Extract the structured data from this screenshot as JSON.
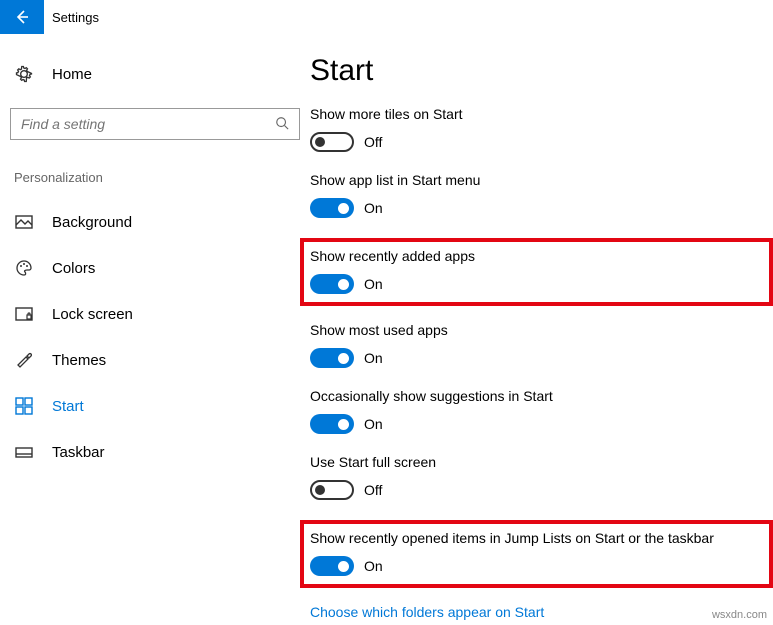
{
  "titlebar": {
    "title": "Settings"
  },
  "sidebar": {
    "home": "Home",
    "search_placeholder": "Find a setting",
    "section": "Personalization",
    "items": [
      {
        "label": "Background"
      },
      {
        "label": "Colors"
      },
      {
        "label": "Lock screen"
      },
      {
        "label": "Themes"
      },
      {
        "label": "Start"
      },
      {
        "label": "Taskbar"
      }
    ]
  },
  "main": {
    "title": "Start",
    "settings": [
      {
        "label": "Show more tiles on Start",
        "state": "Off",
        "on": false,
        "highlight": false
      },
      {
        "label": "Show app list in Start menu",
        "state": "On",
        "on": true,
        "highlight": false
      },
      {
        "label": "Show recently added apps",
        "state": "On",
        "on": true,
        "highlight": true
      },
      {
        "label": "Show most used apps",
        "state": "On",
        "on": true,
        "highlight": false
      },
      {
        "label": "Occasionally show suggestions in Start",
        "state": "On",
        "on": true,
        "highlight": false
      },
      {
        "label": "Use Start full screen",
        "state": "Off",
        "on": false,
        "highlight": false
      },
      {
        "label": "Show recently opened items in Jump Lists on Start or the taskbar",
        "state": "On",
        "on": true,
        "highlight": true
      }
    ],
    "link": "Choose which folders appear on Start"
  },
  "watermark": "wsxdn.com"
}
